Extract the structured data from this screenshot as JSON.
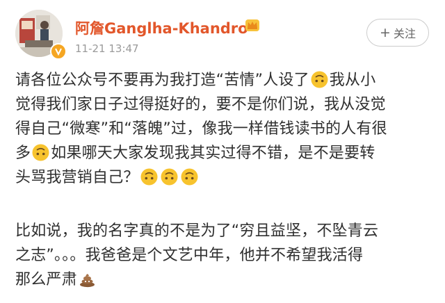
{
  "user": {
    "name": "阿詹Ganglha-Khandro",
    "timestamp": "11-21  13:47",
    "verified_badge": "yellow-v-badge",
    "crown_icon": "vip-crown-icon"
  },
  "follow_button": {
    "plus": "+",
    "label": "关注"
  },
  "post": {
    "para1": {
      "l1a": "请各位公众号不要再为我打造“苦情”人设了",
      "l1b": "我从小",
      "l2": "觉得我们家日子过得挺好的，要不是你们说，我从没觉",
      "l3": "得自己“微寒”和“落魄”过，像我一样借钱读书的人有很",
      "l4a": "多",
      "l4b": "如果哪天大家发现我其实过得不错，是不是要转",
      "l5": "头骂我营销自己？"
    },
    "para2": {
      "l1": "比如说，我的名字真的不是为了“穷且益坚，不坠青云",
      "l2": "之志”。。。我爸爸是个文艺中年，他并不希望我活得",
      "l3": "那么严肃"
    }
  },
  "emoji": {
    "upside_down": "upside-down-face",
    "poop": "pile-of-poo"
  },
  "colors": {
    "username": "#e2572b",
    "timestamp": "#9a9a9a",
    "text": "#2f2f2f",
    "badge": "#f5a623"
  }
}
